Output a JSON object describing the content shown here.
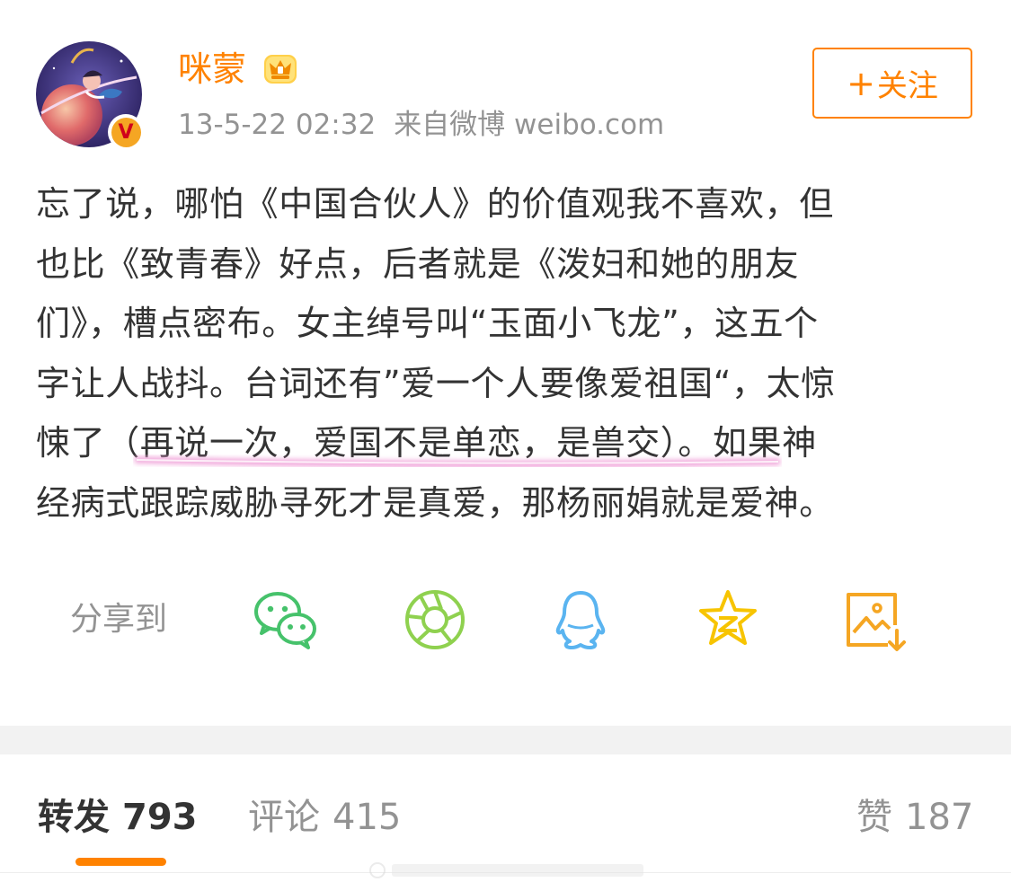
{
  "user": {
    "name": "咪蒙",
    "timestamp": "13-5-22 02:32",
    "source": "来自微博 weibo.com",
    "verified_mark": "V"
  },
  "follow": {
    "plus": "+",
    "label": "关注"
  },
  "post": {
    "line1": "忘了说，哪怕《中国合伙人》的价值观我不喜欢，但",
    "line2": "也比《致青春》好点，后者就是《泼妇和她的朋友",
    "line3": "们》，槽点密布。女主绰号叫“玉面小飞龙”，这五个",
    "line4": "字让人战抖。台词还有”爱一个人要像爱祖国“，太惊",
    "line5": "悚了（再说一次，爱国不是单恋，是兽交）。如果神",
    "line6": "经病式跟踪威胁寻死才是真爱，那杨丽娟就是爱神。"
  },
  "share": {
    "label": "分享到",
    "icons": [
      "wechat-icon",
      "moments-icon",
      "qq-icon",
      "qzone-icon",
      "save-image-icon"
    ]
  },
  "tabs": {
    "repost_label": "转发",
    "repost_count": "793",
    "comment_label": "评论",
    "comment_count": "415",
    "like_label": "赞",
    "like_count": "187"
  },
  "colors": {
    "accent": "#ff8200",
    "text": "#333333",
    "muted": "#939393",
    "highlight": "#f0a0d8",
    "wechat": "#46c26b",
    "moments": "#8fd14f",
    "qq": "#5ab4f0",
    "qzone": "#f7c400",
    "save": "#f5a623"
  }
}
